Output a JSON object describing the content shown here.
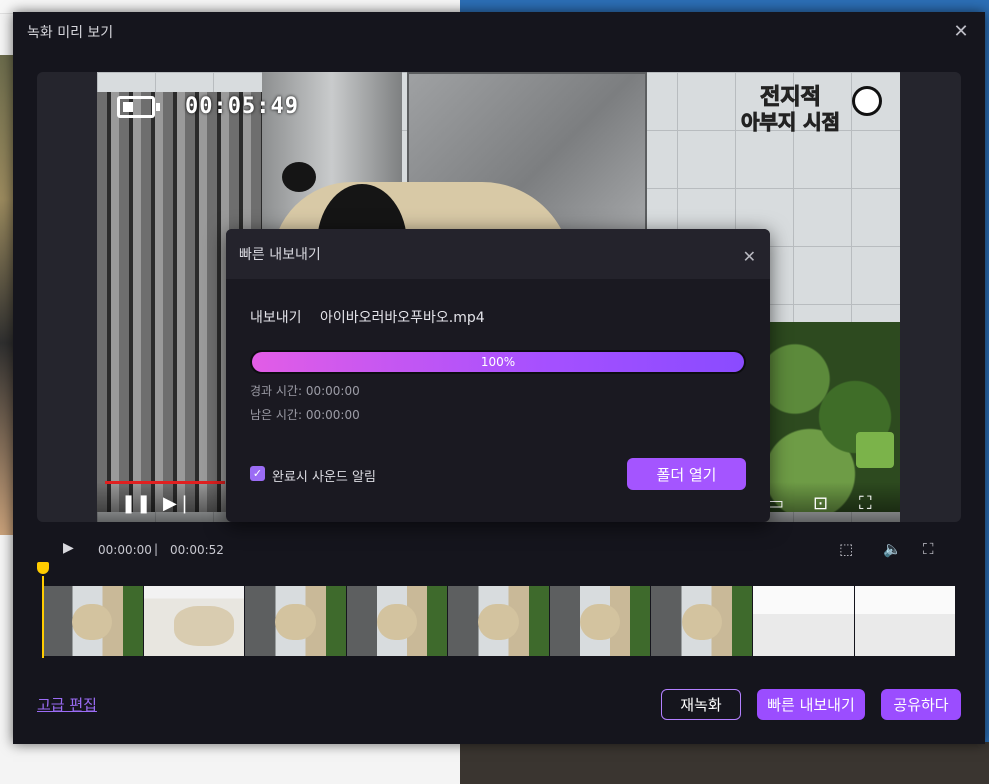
{
  "window": {
    "title": "녹화 미리 보기",
    "close_icon": "close-icon"
  },
  "video": {
    "overlay_time": "00:05:49",
    "brand_line1": "전지적",
    "brand_line2": "아부지 시점"
  },
  "player": {
    "current_time": "00:00:00",
    "separator": "|",
    "duration": "00:00:52",
    "icons": [
      "play-icon",
      "crop-icon",
      "volume-icon",
      "fullscreen-icon"
    ]
  },
  "timeline": {
    "frame_count": 9
  },
  "actions": {
    "advanced_edit": "고급 편집",
    "rerecord": "재녹화",
    "quick_export": "빠른 내보내기",
    "share": "공유하다",
    "accent_color": "#9b4dff"
  },
  "modal": {
    "title": "빠른 내보내기",
    "export_label": "내보내기",
    "filename": "아이바오러바오푸바오.mp4",
    "progress_percent": 100,
    "progress_text": "100%",
    "elapsed": "경과 시간: 00:00:00",
    "remaining": "남은 시간: 00:00:00",
    "sound_alert_label": "완료시 사운드 알림",
    "sound_alert_checked": true,
    "open_folder": "폴더 열기"
  }
}
